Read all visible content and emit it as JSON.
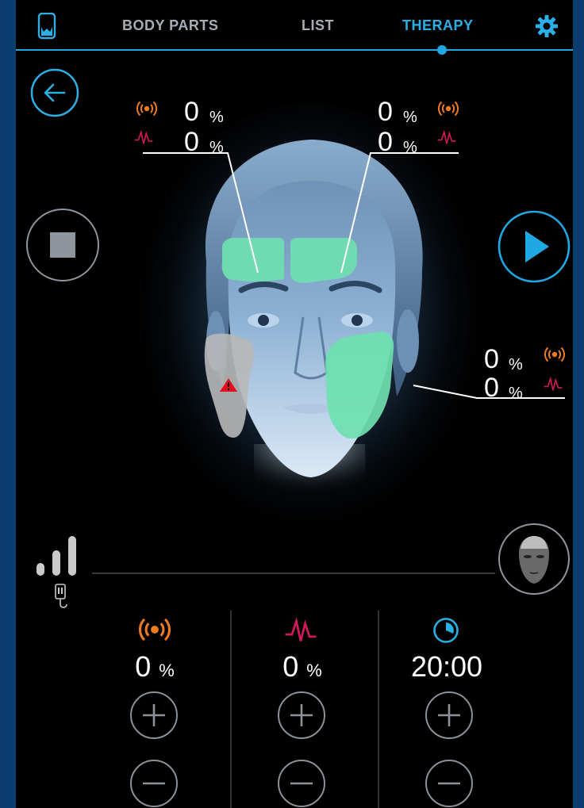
{
  "nav": {
    "tabs": [
      {
        "label": "BODY PARTS",
        "active": false
      },
      {
        "label": "LIST",
        "active": false
      },
      {
        "label": "THERAPY",
        "active": true
      }
    ],
    "accent": "#1fa9e4"
  },
  "zones": {
    "forehead_left": {
      "vibration": "0",
      "pulse": "0",
      "unit": "%"
    },
    "forehead_right": {
      "vibration": "0",
      "pulse": "0",
      "unit": "%"
    },
    "cheek_right": {
      "vibration": "0",
      "pulse": "0",
      "unit": "%"
    }
  },
  "controls": {
    "vibration": {
      "value": "0",
      "unit": "%",
      "color": "#f07a1e"
    },
    "pulse": {
      "value": "0",
      "unit": "%",
      "color": "#d0195a"
    },
    "timer": {
      "value": "20:00",
      "color": "#2bb0e6"
    }
  },
  "signal": {
    "level": 3,
    "max": 3
  },
  "colors": {
    "zone_active": "#6fe0b0",
    "zone_inactive": "#b8b8b8",
    "warning": "#e0101a"
  }
}
